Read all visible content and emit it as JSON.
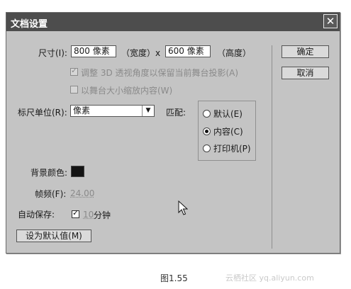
{
  "dialog": {
    "title": "文档设置",
    "close_glyph": "✕",
    "size_label": "尺寸(I):",
    "width_value": "800 像素",
    "width_label": "（宽度）x",
    "height_value": "600 像素",
    "height_label": "（高度）",
    "adjust_3d_label": "调整 3D 透视角度以保留当前舞台投影(A)",
    "scale_content_label": "以舞台大小缩放内容(W)",
    "ruler_units_label": "标尺单位(R):",
    "ruler_units_value": "像素",
    "match_label": "匹配:",
    "match_options": [
      "默认(E)",
      "内容(C)",
      "打印机(P)"
    ],
    "match_selected": "内容(C)",
    "bg_color_label": "背景颜色:",
    "bg_color": "#141414",
    "frame_rate_label": "帧频(F):",
    "frame_rate_value": "24.00",
    "autosave_label": "自动保存:",
    "autosave_value": "10",
    "autosave_unit": "分钟",
    "make_default_label": "设为默认值(M)",
    "ok_label": "确定",
    "cancel_label": "取消"
  },
  "caption": "图1.55",
  "watermark": "云栖社区 yq.aliyun.com"
}
